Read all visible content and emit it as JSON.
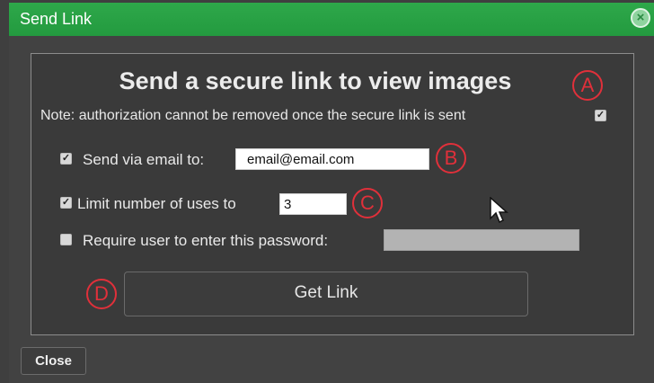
{
  "dialog": {
    "title": "Send Link",
    "close_icon": "close-circle-icon"
  },
  "content": {
    "heading": "Send a secure link to view images",
    "note": "Note: authorization cannot be removed once the secure link is sent",
    "note_checked": true
  },
  "options": {
    "email": {
      "checked": true,
      "label": "Send via email to:",
      "value": "email@email.com"
    },
    "limit": {
      "checked": true,
      "label": "Limit number of uses to",
      "value": "3"
    },
    "password": {
      "checked": false,
      "label": "Require user to enter this password:",
      "value": ""
    }
  },
  "actions": {
    "get_link": "Get Link",
    "close": "Close"
  },
  "annotations": {
    "a": "A",
    "b": "B",
    "c": "C",
    "d": "D",
    "color": "#e0303a"
  }
}
